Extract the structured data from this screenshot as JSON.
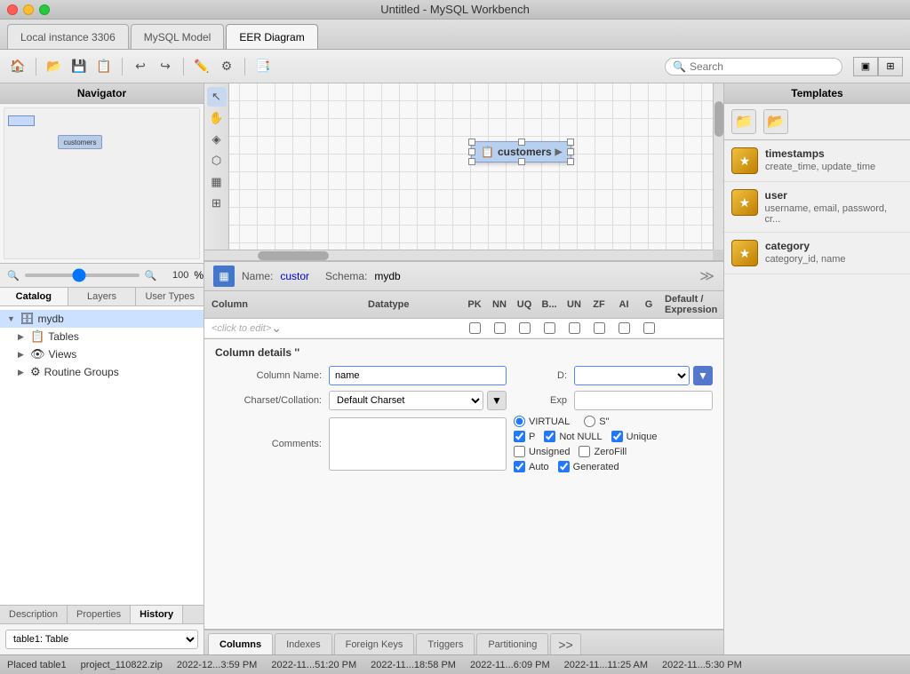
{
  "window": {
    "title": "Untitled - MySQL Workbench"
  },
  "tabs": [
    {
      "id": "local",
      "label": "Local instance 3306",
      "active": false
    },
    {
      "id": "mysql_model",
      "label": "MySQL Model",
      "active": false
    },
    {
      "id": "eer",
      "label": "EER Diagram",
      "active": true
    }
  ],
  "toolbar": {
    "search_placeholder": "Search",
    "zoom_value": "100"
  },
  "navigator": {
    "title": "Navigator",
    "zoom_value": "100"
  },
  "catalog_tabs": [
    {
      "label": "Catalog",
      "active": true
    },
    {
      "label": "Layers",
      "active": false
    },
    {
      "label": "User Types",
      "active": false
    }
  ],
  "tree": {
    "items": [
      {
        "label": "mydb",
        "level": 0,
        "icon": "db",
        "expanded": true
      },
      {
        "label": "Tables",
        "level": 1,
        "icon": "table",
        "expanded": false
      },
      {
        "label": "Views",
        "level": 1,
        "icon": "view",
        "expanded": false
      },
      {
        "label": "Routine Groups",
        "level": 1,
        "icon": "routine",
        "expanded": false
      }
    ]
  },
  "bottom_left_tabs": [
    {
      "label": "Description",
      "active": false
    },
    {
      "label": "Properties",
      "active": false
    },
    {
      "label": "History",
      "active": true
    }
  ],
  "bottom_panel": {
    "select_label": "table1: Table",
    "select_value": "table1: Table"
  },
  "canvas": {
    "table_node": {
      "label": "customers"
    }
  },
  "table_editor": {
    "name_label": "Name:",
    "name_value": "custor",
    "schema_label": "Schema:",
    "schema_value": "mydb"
  },
  "column_grid": {
    "headers": [
      "Column",
      "Datatype",
      "PK",
      "NN",
      "UQ",
      "B...",
      "UN",
      "ZF",
      "AI",
      "G",
      "Default / Expression"
    ],
    "rows": [
      {
        "name": "<click to edit>",
        "datatype": "",
        "pk": false,
        "nn": false,
        "uq": false,
        "b": false,
        "un": false,
        "zf": false,
        "ai": false,
        "g": false,
        "default": ""
      }
    ]
  },
  "column_details": {
    "title": "Column details ''",
    "column_name_label": "Column Name:",
    "column_name_value": "name",
    "datatype_label": "D:",
    "charset_label": "Charset/Collation:",
    "charset_placeholder": "Default Charset",
    "exp_label": "Exp",
    "comments_label": "Comments:",
    "virtual_label": "VIRTUAL",
    "s_label": "S\"",
    "p_label": "P",
    "not_null_label": "Not NULL",
    "unique_label": "Unique",
    "unsigned_label": "Unsigned",
    "zerofill_label": "ZeroFill",
    "auto_label": "Auto",
    "generated_label": "Generated"
  },
  "bottom_tabs": [
    {
      "label": "Columns",
      "active": true
    },
    {
      "label": "Indexes",
      "active": false
    },
    {
      "label": "Foreign Keys",
      "active": false
    },
    {
      "label": "Triggers",
      "active": false
    },
    {
      "label": "Partitioning",
      "active": false
    },
    {
      "label": ">>",
      "active": false
    }
  ],
  "templates": {
    "title": "Templates",
    "items": [
      {
        "name": "timestamps",
        "description": "create_time, update_time"
      },
      {
        "name": "user",
        "description": "username, email, password, cr..."
      },
      {
        "name": "category",
        "description": "category_id, name"
      }
    ]
  },
  "status_bar": {
    "items": [
      "Placed table1",
      "project_110822.zip",
      "2022-12...3:59 PM",
      "2022-11...51:20 PM",
      "2022-11...18:58 PM",
      "2022-11...6:09 PM",
      "2022-11...11:25 AM",
      "2022-11...5:30 PM"
    ]
  }
}
